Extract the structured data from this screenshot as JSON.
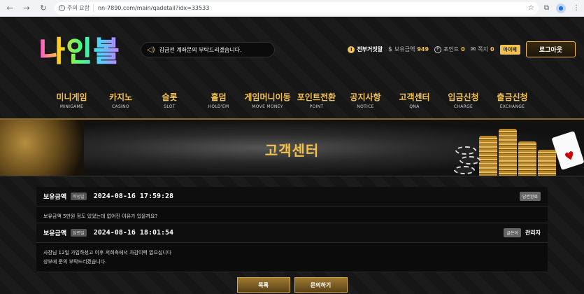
{
  "browser": {
    "security_label": "주의 요함",
    "url": "nn-7890.com/main/qadetail?idx=33533"
  },
  "header": {
    "logo_text": "나인볼",
    "notice_text": "김금전 계좌문의 부탁드리겠습니다.",
    "user": {
      "name": "전부거짓말",
      "balance_label": "보유금액",
      "balance_value": "949",
      "point_label": "포인트",
      "point_value": "0",
      "message_label": "쪽지",
      "message_value": "0",
      "mypage_label": "마이페",
      "logout_label": "로그아웃"
    }
  },
  "nav": [
    {
      "ko": "미니게임",
      "en": "MINIGAME"
    },
    {
      "ko": "카지노",
      "en": "CASINO"
    },
    {
      "ko": "슬롯",
      "en": "SLOT"
    },
    {
      "ko": "홀덤",
      "en": "HOLD'EM"
    },
    {
      "ko": "게임머니이동",
      "en": "MOVE MONEY"
    },
    {
      "ko": "포인트전환",
      "en": "POINT"
    },
    {
      "ko": "공지사항",
      "en": "NOTICE"
    },
    {
      "ko": "고객센터",
      "en": "QNA"
    },
    {
      "ko": "입금신청",
      "en": "CHARGE"
    },
    {
      "ko": "출금신청",
      "en": "EXCHANGE"
    }
  ],
  "banner": {
    "title": "고객센터"
  },
  "question": {
    "label": "보유금액",
    "tag": "작성일",
    "date": "2024-08-16 17:59:28",
    "status": "답변완료",
    "body": "보유금액 5만원 정도 있었는데 없어진 이유가 있을까요?"
  },
  "answer": {
    "label": "보유금액",
    "tag": "답변일",
    "date": "2024-08-16 18:01:54",
    "role_tag": "글쓴이",
    "author": "관리자",
    "body_line1": "사장님 12일 가입하셨고 이후 저희측에서 차감이력 없으십니다",
    "body_line2": "상부에 문의 부탁드리겠습니다."
  },
  "buttons": {
    "list": "목록",
    "inquire": "문의하기"
  },
  "colors": {
    "accent_gold": "#f2c14e"
  }
}
